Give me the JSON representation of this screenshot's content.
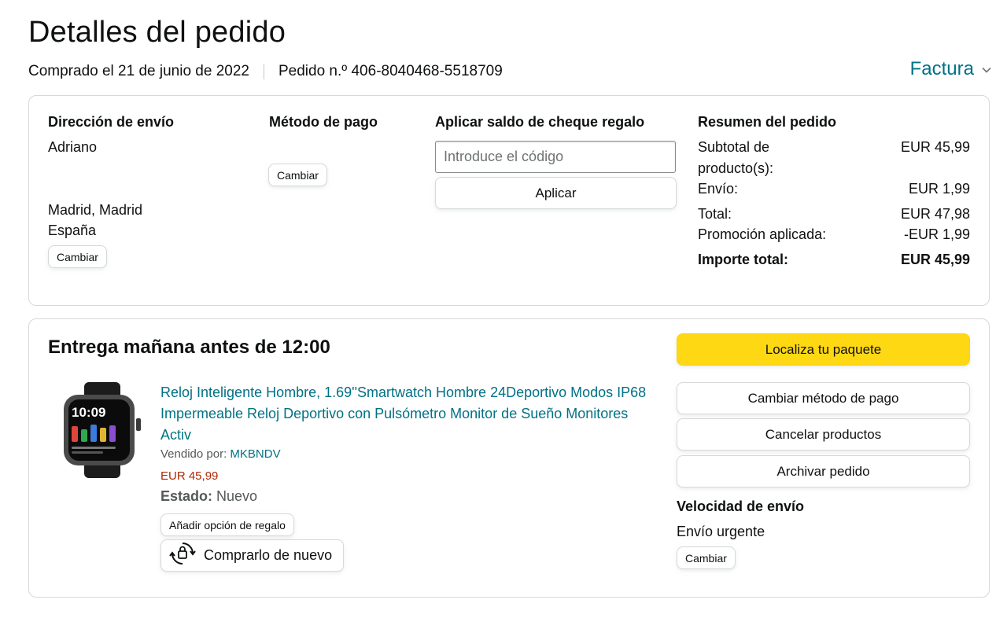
{
  "page": {
    "title": "Detalles del pedido",
    "purchase_date": "Comprado el 21 de junio de 2022",
    "order_number": "Pedido n.º 406-8040468-5518709",
    "invoice_label": "Factura"
  },
  "shipping": {
    "heading": "Dirección de envío",
    "name": "Adriano",
    "city": "Madrid, Madrid",
    "country": "España",
    "change_label": "Cambiar"
  },
  "payment": {
    "heading": "Método de pago",
    "change_label": "Cambiar"
  },
  "gift_card": {
    "heading": "Aplicar saldo de cheque regalo",
    "placeholder": "Introduce el código",
    "value": "",
    "apply_label": "Aplicar"
  },
  "summary": {
    "heading": "Resumen del pedido",
    "rows": [
      {
        "label": "Subtotal de producto(s):",
        "value": "EUR 45,99"
      },
      {
        "label": "Envío:",
        "value": "EUR 1,99"
      },
      {
        "label": "Total:",
        "value": "EUR 47,98"
      },
      {
        "label": "Promoción aplicada:",
        "value": "-EUR 1,99"
      },
      {
        "label": "Importe total:",
        "value": "EUR 45,99"
      }
    ]
  },
  "delivery": {
    "title": "Entrega mañana antes de 12:00",
    "product": {
      "title": "Reloj Inteligente Hombre, 1.69''Smartwatch Hombre 24Deportivo Modos IP68 Impermeable Reloj Deportivo con Pulsómetro Monitor de Sueño Monitores Activ",
      "sold_by_label": "Vendido por:",
      "seller": "MKBNDV",
      "price": "EUR 45,99",
      "condition_label": "Estado:",
      "condition_value": "Nuevo",
      "gift_option_label": "Añadir opción de regalo",
      "buy_again_label": "Comprarlo de nuevo",
      "image_screen_time": "10:09"
    },
    "actions": {
      "track_label": "Localiza tu paquete",
      "change_payment_label": "Cambiar método de pago",
      "cancel_label": "Cancelar productos",
      "archive_label": "Archivar pedido"
    },
    "speed": {
      "heading": "Velocidad de envío",
      "value": "Envío urgente",
      "change_label": "Cambiar"
    }
  },
  "colors": {
    "link": "#007185",
    "price": "#b12704",
    "primary_button": "#ffd814",
    "border": "#d5d9d9"
  }
}
